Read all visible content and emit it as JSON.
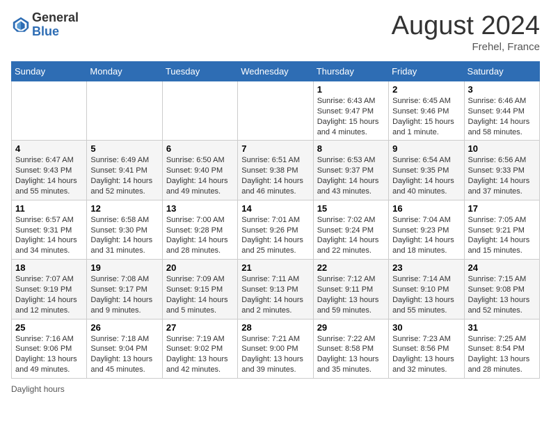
{
  "header": {
    "logo_general": "General",
    "logo_blue": "Blue",
    "month_title": "August 2024",
    "subtitle": "Frehel, France"
  },
  "footer": {
    "daylight_label": "Daylight hours"
  },
  "weekdays": [
    "Sunday",
    "Monday",
    "Tuesday",
    "Wednesday",
    "Thursday",
    "Friday",
    "Saturday"
  ],
  "weeks": [
    [
      null,
      null,
      null,
      null,
      {
        "day": 1,
        "sunrise": "Sunrise: 6:43 AM",
        "sunset": "Sunset: 9:47 PM",
        "daylight": "Daylight: 15 hours and 4 minutes."
      },
      {
        "day": 2,
        "sunrise": "Sunrise: 6:45 AM",
        "sunset": "Sunset: 9:46 PM",
        "daylight": "Daylight: 15 hours and 1 minute."
      },
      {
        "day": 3,
        "sunrise": "Sunrise: 6:46 AM",
        "sunset": "Sunset: 9:44 PM",
        "daylight": "Daylight: 14 hours and 58 minutes."
      }
    ],
    [
      {
        "day": 4,
        "sunrise": "Sunrise: 6:47 AM",
        "sunset": "Sunset: 9:43 PM",
        "daylight": "Daylight: 14 hours and 55 minutes."
      },
      {
        "day": 5,
        "sunrise": "Sunrise: 6:49 AM",
        "sunset": "Sunset: 9:41 PM",
        "daylight": "Daylight: 14 hours and 52 minutes."
      },
      {
        "day": 6,
        "sunrise": "Sunrise: 6:50 AM",
        "sunset": "Sunset: 9:40 PM",
        "daylight": "Daylight: 14 hours and 49 minutes."
      },
      {
        "day": 7,
        "sunrise": "Sunrise: 6:51 AM",
        "sunset": "Sunset: 9:38 PM",
        "daylight": "Daylight: 14 hours and 46 minutes."
      },
      {
        "day": 8,
        "sunrise": "Sunrise: 6:53 AM",
        "sunset": "Sunset: 9:37 PM",
        "daylight": "Daylight: 14 hours and 43 minutes."
      },
      {
        "day": 9,
        "sunrise": "Sunrise: 6:54 AM",
        "sunset": "Sunset: 9:35 PM",
        "daylight": "Daylight: 14 hours and 40 minutes."
      },
      {
        "day": 10,
        "sunrise": "Sunrise: 6:56 AM",
        "sunset": "Sunset: 9:33 PM",
        "daylight": "Daylight: 14 hours and 37 minutes."
      }
    ],
    [
      {
        "day": 11,
        "sunrise": "Sunrise: 6:57 AM",
        "sunset": "Sunset: 9:31 PM",
        "daylight": "Daylight: 14 hours and 34 minutes."
      },
      {
        "day": 12,
        "sunrise": "Sunrise: 6:58 AM",
        "sunset": "Sunset: 9:30 PM",
        "daylight": "Daylight: 14 hours and 31 minutes."
      },
      {
        "day": 13,
        "sunrise": "Sunrise: 7:00 AM",
        "sunset": "Sunset: 9:28 PM",
        "daylight": "Daylight: 14 hours and 28 minutes."
      },
      {
        "day": 14,
        "sunrise": "Sunrise: 7:01 AM",
        "sunset": "Sunset: 9:26 PM",
        "daylight": "Daylight: 14 hours and 25 minutes."
      },
      {
        "day": 15,
        "sunrise": "Sunrise: 7:02 AM",
        "sunset": "Sunset: 9:24 PM",
        "daylight": "Daylight: 14 hours and 22 minutes."
      },
      {
        "day": 16,
        "sunrise": "Sunrise: 7:04 AM",
        "sunset": "Sunset: 9:23 PM",
        "daylight": "Daylight: 14 hours and 18 minutes."
      },
      {
        "day": 17,
        "sunrise": "Sunrise: 7:05 AM",
        "sunset": "Sunset: 9:21 PM",
        "daylight": "Daylight: 14 hours and 15 minutes."
      }
    ],
    [
      {
        "day": 18,
        "sunrise": "Sunrise: 7:07 AM",
        "sunset": "Sunset: 9:19 PM",
        "daylight": "Daylight: 14 hours and 12 minutes."
      },
      {
        "day": 19,
        "sunrise": "Sunrise: 7:08 AM",
        "sunset": "Sunset: 9:17 PM",
        "daylight": "Daylight: 14 hours and 9 minutes."
      },
      {
        "day": 20,
        "sunrise": "Sunrise: 7:09 AM",
        "sunset": "Sunset: 9:15 PM",
        "daylight": "Daylight: 14 hours and 5 minutes."
      },
      {
        "day": 21,
        "sunrise": "Sunrise: 7:11 AM",
        "sunset": "Sunset: 9:13 PM",
        "daylight": "Daylight: 14 hours and 2 minutes."
      },
      {
        "day": 22,
        "sunrise": "Sunrise: 7:12 AM",
        "sunset": "Sunset: 9:11 PM",
        "daylight": "Daylight: 13 hours and 59 minutes."
      },
      {
        "day": 23,
        "sunrise": "Sunrise: 7:14 AM",
        "sunset": "Sunset: 9:10 PM",
        "daylight": "Daylight: 13 hours and 55 minutes."
      },
      {
        "day": 24,
        "sunrise": "Sunrise: 7:15 AM",
        "sunset": "Sunset: 9:08 PM",
        "daylight": "Daylight: 13 hours and 52 minutes."
      }
    ],
    [
      {
        "day": 25,
        "sunrise": "Sunrise: 7:16 AM",
        "sunset": "Sunset: 9:06 PM",
        "daylight": "Daylight: 13 hours and 49 minutes."
      },
      {
        "day": 26,
        "sunrise": "Sunrise: 7:18 AM",
        "sunset": "Sunset: 9:04 PM",
        "daylight": "Daylight: 13 hours and 45 minutes."
      },
      {
        "day": 27,
        "sunrise": "Sunrise: 7:19 AM",
        "sunset": "Sunset: 9:02 PM",
        "daylight": "Daylight: 13 hours and 42 minutes."
      },
      {
        "day": 28,
        "sunrise": "Sunrise: 7:21 AM",
        "sunset": "Sunset: 9:00 PM",
        "daylight": "Daylight: 13 hours and 39 minutes."
      },
      {
        "day": 29,
        "sunrise": "Sunrise: 7:22 AM",
        "sunset": "Sunset: 8:58 PM",
        "daylight": "Daylight: 13 hours and 35 minutes."
      },
      {
        "day": 30,
        "sunrise": "Sunrise: 7:23 AM",
        "sunset": "Sunset: 8:56 PM",
        "daylight": "Daylight: 13 hours and 32 minutes."
      },
      {
        "day": 31,
        "sunrise": "Sunrise: 7:25 AM",
        "sunset": "Sunset: 8:54 PM",
        "daylight": "Daylight: 13 hours and 28 minutes."
      }
    ]
  ]
}
